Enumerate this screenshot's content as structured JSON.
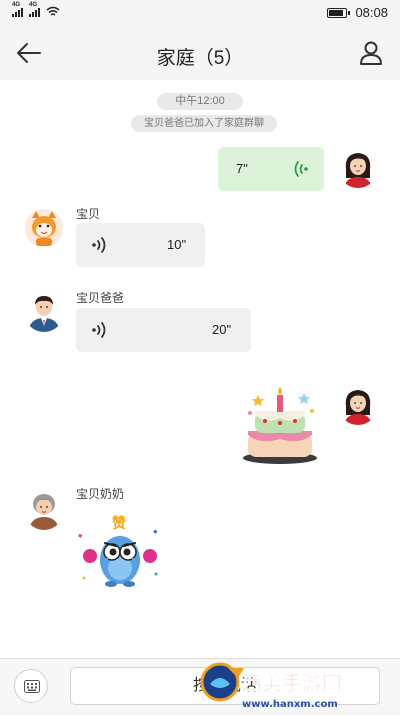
{
  "status_bar": {
    "signal_1_label": "4G",
    "signal_2_label": "4G",
    "battery_level": 0.9,
    "time": "08:08"
  },
  "header": {
    "title": "家庭（5）",
    "back_icon": "arrow-left-icon",
    "profile_icon": "person-icon"
  },
  "chat": {
    "system_time": "中午12:00",
    "system_notice": "宝贝爸爸已加入了家庭群聊",
    "messages": [
      {
        "sender": "me",
        "type": "voice",
        "duration": "7\""
      },
      {
        "sender": "宝贝",
        "type": "voice",
        "duration": "10\""
      },
      {
        "sender": "宝贝爸爸",
        "type": "voice",
        "duration": "20\""
      },
      {
        "sender": "me",
        "type": "sticker",
        "sticker": "birthday-cake"
      },
      {
        "sender": "宝贝奶奶",
        "type": "sticker",
        "sticker": "thumbs-up-monster",
        "sticker_text": "赞"
      }
    ]
  },
  "input_bar": {
    "keyboard_icon": "keyboard-icon",
    "hold_to_talk": "按住说话"
  },
  "watermark": {
    "brand": "西美手游网",
    "url": "www.hanxm.com"
  },
  "colors": {
    "my_bubble": "#dcf3d9",
    "other_bubble": "#f0f0f0",
    "my_voice_icon": "#2f9e3f"
  }
}
